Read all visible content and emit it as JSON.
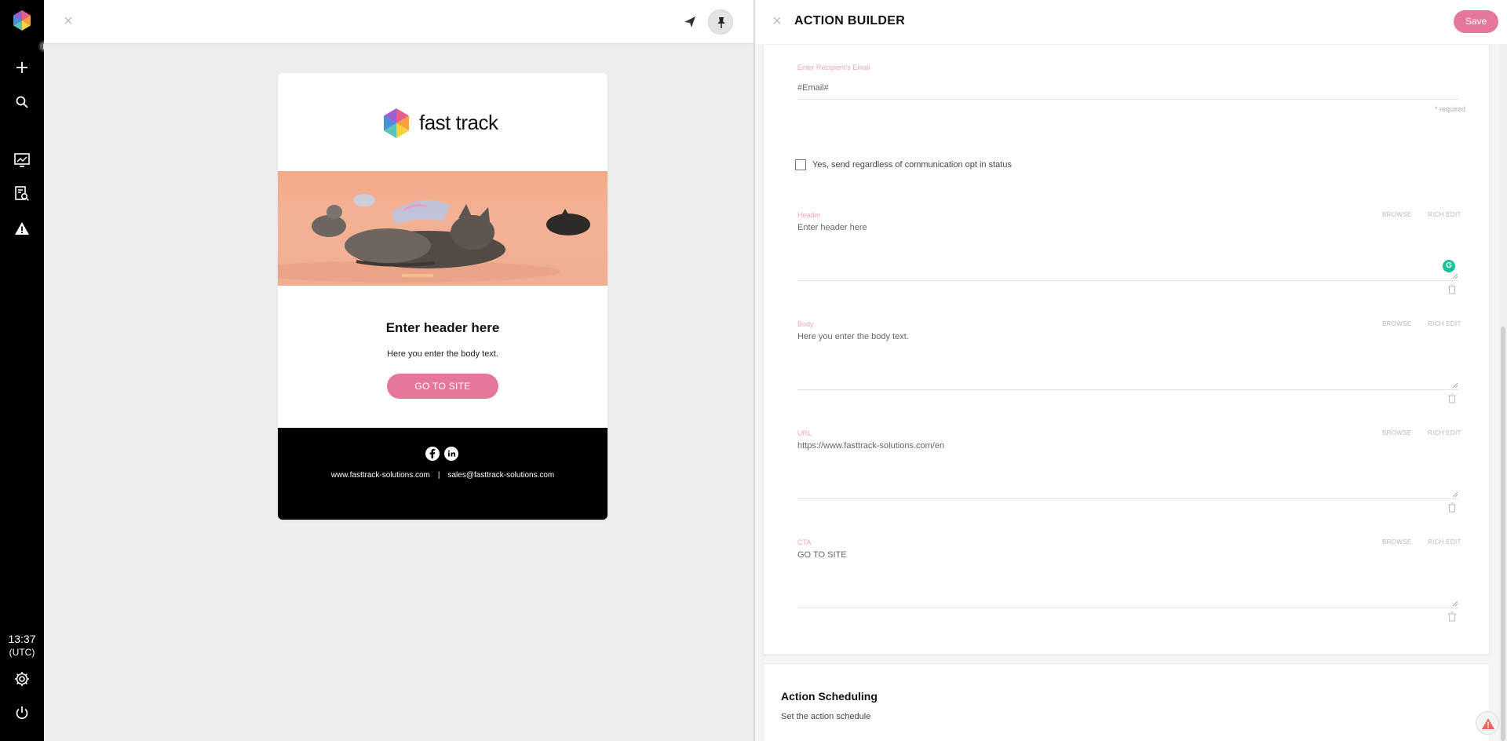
{
  "sidebar": {
    "time": "13:37",
    "timezone": "(UTC)",
    "icons": [
      "logo-icon",
      "expand-icon",
      "plus-icon",
      "search-icon",
      "dashboard-icon",
      "report-search-icon",
      "alert-triangle-icon",
      "settings-icon",
      "power-icon"
    ]
  },
  "preview": {
    "close_glyph": "×",
    "email": {
      "brand": "fast track",
      "header": "Enter header here",
      "body": "Here you enter the body text.",
      "cta": "GO TO SITE",
      "footer_website": "www.fasttrack-solutions.com",
      "footer_separator": "|",
      "footer_email": "sales@fasttrack-solutions.com"
    }
  },
  "builder": {
    "close_glyph": "×",
    "title": "ACTION BUILDER",
    "save_label": "Save",
    "recipient": {
      "label": "Enter Recipient's Email",
      "value": "#Email#",
      "required_note": "* required"
    },
    "opt_checkbox_label": "Yes, send regardless of communication opt in status",
    "browse_label": "BROWSE",
    "rich_edit_label": "RICH EDIT",
    "fields": [
      {
        "label": "Header",
        "value": "Enter header here"
      },
      {
        "label": "Body",
        "value": "Here you enter the body text."
      },
      {
        "label": "URL",
        "value": "https://www.fasttrack-solutions.com/en"
      },
      {
        "label": "CTA",
        "value": "GO TO SITE"
      }
    ],
    "grammarly_glyph": "G",
    "scheduling": {
      "title": "Action Scheduling",
      "subtitle": "Set the action schedule"
    }
  },
  "colors": {
    "accent_pink": "#e57799",
    "label_pink": "#e7a7bd",
    "sidebar_bg": "#000000"
  }
}
